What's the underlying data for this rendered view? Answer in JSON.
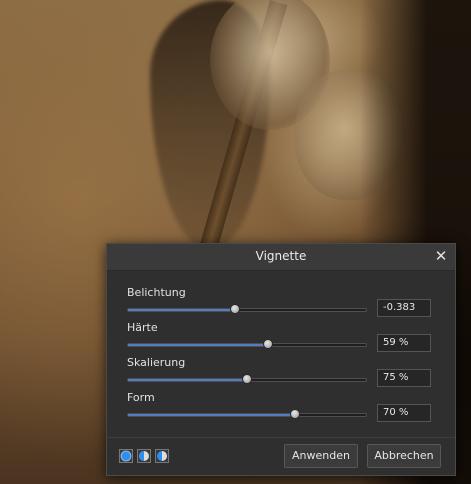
{
  "dialog": {
    "title": "Vignette",
    "close_icon": "close-icon",
    "params": [
      {
        "label": "Belichtung",
        "value_text": "-0.383",
        "slider_fraction": 0.45
      },
      {
        "label": "Härte",
        "value_text": "59 %",
        "slider_fraction": 0.59
      },
      {
        "label": "Skalierung",
        "value_text": "75 %",
        "slider_fraction": 0.5
      },
      {
        "label": "Form",
        "value_text": "70 %",
        "slider_fraction": 0.7
      }
    ],
    "mode_icons": [
      "full-circle-icon",
      "half-circle-left-icon",
      "half-circle-right-icon"
    ],
    "apply_label": "Anwenden",
    "cancel_label": "Abbrechen"
  },
  "colors": {
    "accent": "#4f7fc2",
    "dialog_bg": "#2f2f2f"
  }
}
